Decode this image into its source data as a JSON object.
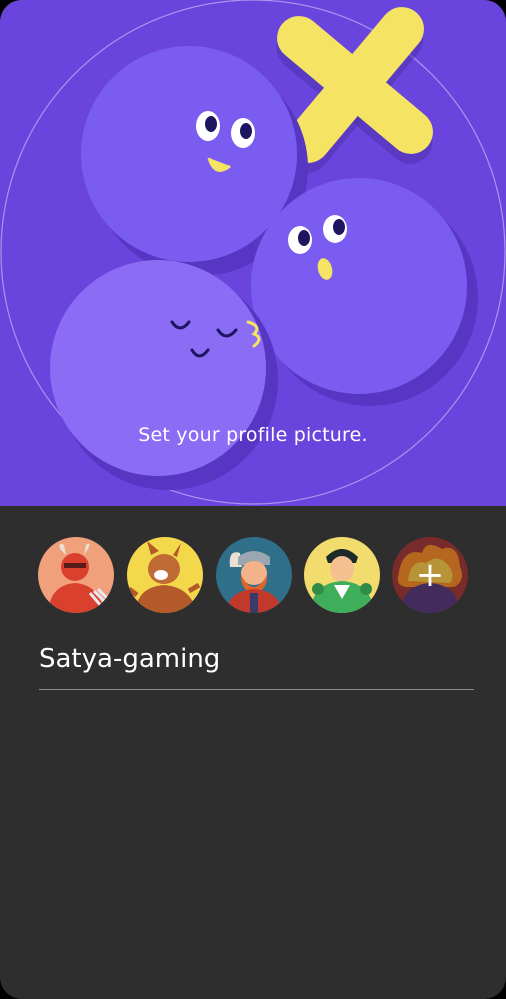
{
  "hero": {
    "caption": "Set your profile picture.",
    "colors": {
      "background": "#6a45dd",
      "ball": "#7b5cf0",
      "cross": "#f5e463"
    }
  },
  "avatars": [
    {
      "name": "red-devil-avatar",
      "bg": "#f0a07a"
    },
    {
      "name": "werewolf-avatar",
      "bg": "#f4d84c"
    },
    {
      "name": "viking-avatar",
      "bg": "#2f6f8a"
    },
    {
      "name": "green-hero-avatar",
      "bg": "#f2dc6e"
    },
    {
      "name": "custom-avatar-add",
      "bg": "#a03a3a",
      "add_symbol": "+"
    }
  ],
  "profile": {
    "username": "Satya-gaming"
  }
}
